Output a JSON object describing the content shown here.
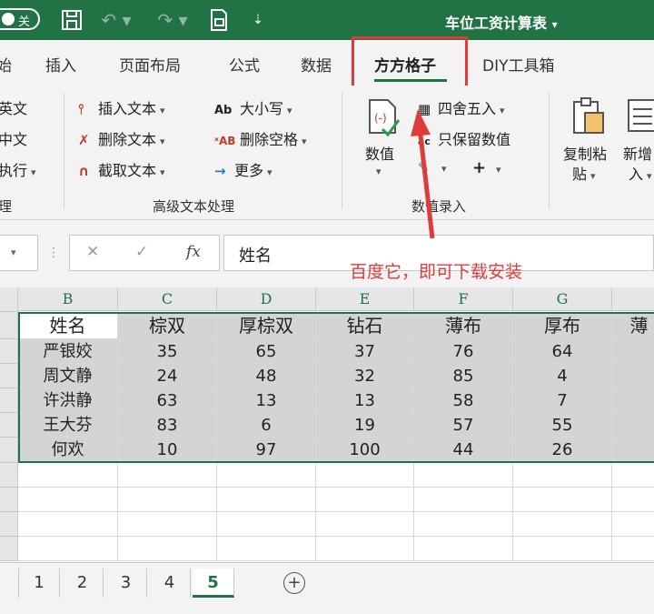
{
  "titlebar": {
    "autosave_label": "关",
    "title": "车位工资计算表",
    "title_caret": "▾",
    "save_icon": "save-icon",
    "undo_icon": "undo-icon",
    "redo_icon": "redo-icon",
    "print_icon": "print-icon",
    "customize_icon": "customize-icon"
  },
  "tabs": [
    {
      "label": "始"
    },
    {
      "label": "插入"
    },
    {
      "label": "页面布局"
    },
    {
      "label": "公式"
    },
    {
      "label": "数据"
    },
    {
      "label": "方方格子",
      "active": true
    },
    {
      "label": "DIY工具箱"
    }
  ],
  "ribbon": {
    "left_partial": [
      "英文",
      "中文",
      "执行"
    ],
    "left_group_partial": "理",
    "text_group": {
      "items": [
        "插入文本",
        "删除文本",
        "截取文本"
      ],
      "items2": [
        "大小写",
        "删除空格",
        "更多"
      ],
      "label": "高级文本处理"
    },
    "value_group": {
      "big_label": "数值",
      "items": [
        "四舍五入",
        "只保留数值"
      ],
      "label": "数值录入"
    },
    "copy_paste": {
      "line1": "复制粘",
      "line2": "贴"
    },
    "new_insert": {
      "line1": "新增",
      "line2": "入"
    }
  },
  "formula_bar": {
    "fx_label": "fx",
    "cancel_label": "✕",
    "enter_label": "✓",
    "formula_value": "姓名"
  },
  "annotation": "百度它，即可下载安装",
  "grid": {
    "columns": [
      "B",
      "C",
      "D",
      "E",
      "F",
      "G"
    ],
    "header_row": [
      "姓名",
      "棕双",
      "厚棕双",
      "钻石",
      "薄布",
      "厚布",
      "薄"
    ],
    "rows": [
      [
        "严银姣",
        "35",
        "65",
        "37",
        "76",
        "64"
      ],
      [
        "周文静",
        "24",
        "48",
        "32",
        "85",
        "4"
      ],
      [
        "许洪静",
        "63",
        "13",
        "13",
        "58",
        "7"
      ],
      [
        "王大芬",
        "83",
        "6",
        "19",
        "57",
        "55"
      ],
      [
        "何欢",
        "10",
        "97",
        "100",
        "44",
        "26"
      ]
    ]
  },
  "sheets": [
    {
      "label": "1"
    },
    {
      "label": "2"
    },
    {
      "label": "3"
    },
    {
      "label": "4"
    },
    {
      "label": "5",
      "active": true
    }
  ],
  "add_sheet_label": "+"
}
